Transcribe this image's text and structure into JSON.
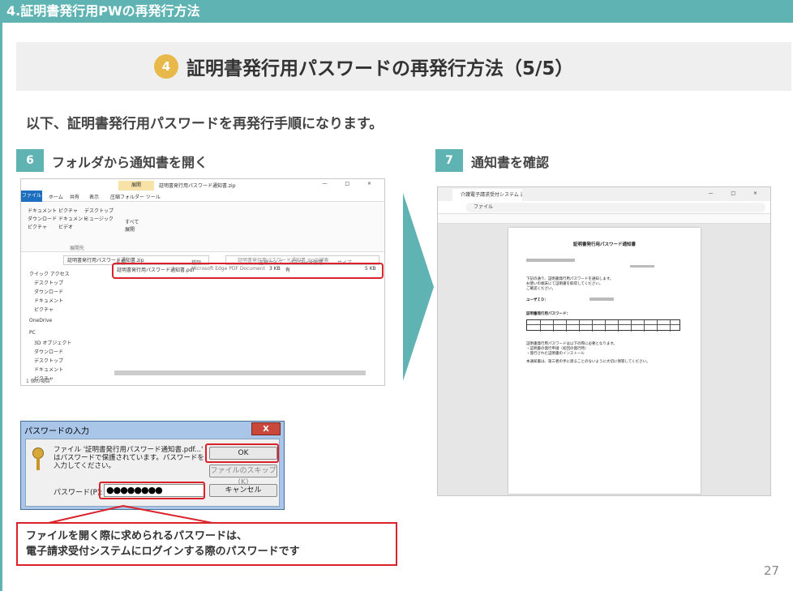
{
  "header": {
    "section_title": "4.証明書発行用PWの再発行方法"
  },
  "title": {
    "number": "4",
    "text": "証明書発行用パスワードの再発行方法（5/5）"
  },
  "intro": "以下、証明書発行用パスワードを再発行手順になります。",
  "steps": [
    {
      "number": "6",
      "label": "フォルダから通知書を開く"
    },
    {
      "number": "7",
      "label": "通知書を確認"
    }
  ],
  "explorer": {
    "ribbon_tag": "展開",
    "window_title": "証明書発行用パスワード通知書.zip",
    "file_tab": "ファイル",
    "tabs": [
      "ホーム",
      "共有",
      "表示",
      "圧縮フォルダー ツール"
    ],
    "ribbon_items": [
      "ドキュメント",
      "ピクチャ",
      "デスクトップ",
      "ダウンロード",
      "ドキュメント",
      "ミュージック",
      "ピクチャ",
      "ビデオ",
      "すべて展開"
    ],
    "ribbon_group": "展開先",
    "path": "証明書発行用パスワード通知書.zip",
    "search_placeholder": "証明書発行用パスワード通知書.zipの検索",
    "columns": [
      "名前",
      "種類",
      "圧縮サイズ",
      "パスワード保護",
      "サイズ"
    ],
    "file": {
      "name": "証明書発行用パスワード通知書.pdf",
      "type": "Microsoft Edge PDF Document",
      "compressed": "3 KB",
      "protected": "有",
      "size": "5 KB"
    },
    "nav": [
      "クイック アクセス",
      "デスクトップ",
      "ダウンロード",
      "ドキュメント",
      "ピクチャ",
      "OneDrive",
      "PC",
      "3D オブジェクト",
      "ダウンロード",
      "デスクトップ",
      "ドキュメント",
      "ピクチャ"
    ],
    "status": "1 個の項目"
  },
  "dialog": {
    "title": "パスワードの入力",
    "close": "X",
    "message": "ファイル '証明書発行用パスワード通知書.pdf...' はパスワードで保護されています。パスワードを入力してください。",
    "password_label": "パスワード(P):",
    "password_value": "●●●●●●●●",
    "ok": "OK",
    "skip": "ファイルのスキップ(K)",
    "cancel": "キャンセル"
  },
  "callout": {
    "line1": "ファイルを開く際に求められるパスワードは、",
    "line2": "電子請求受付システムにログインする際のパスワードです"
  },
  "browser": {
    "tab_title": "介護電子請求受付システム 通知書",
    "url": "ファイル",
    "doc_title": "証明書発行用パスワード通知書",
    "user_label": "ユーザＩＤ：",
    "pw_label": "証明書発行用パスワード：",
    "controls": "— □ ×",
    "lines": [
      "下記の通り、証明書発行用パスワードを通知します。",
      "お使いの端末にて証明書を取得してください。",
      "ご確認ください。",
      "証明書発行用パスワードは以下の際に必要となります。",
      "・証明書の発行申請（初回の発行時）",
      "・発行された証明書のインストール",
      "本通知書は、第三者の手に渡ることのないように大切に保管してください。"
    ]
  },
  "page_number": "27"
}
